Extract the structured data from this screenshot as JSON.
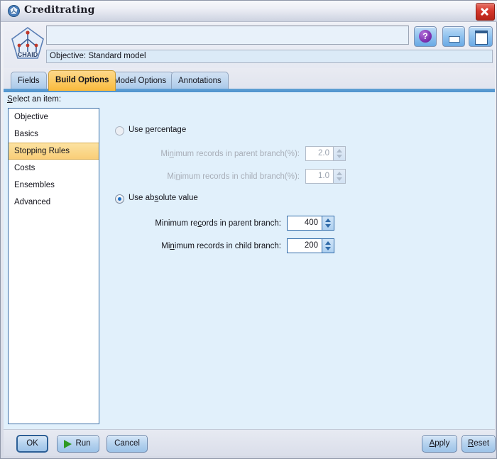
{
  "window": {
    "title": "Creditrating",
    "title_icon": "chaid-node-icon",
    "close_icon": "close-icon"
  },
  "header": {
    "model_icon": "chaid-model-icon",
    "model_icon_label": "CHAID",
    "name_value": "",
    "objective_text": "Objective: Standard model",
    "buttons": [
      {
        "name": "help-button",
        "icon": "help-icon",
        "glyph": "?"
      },
      {
        "name": "minimize-button",
        "icon": "minimize-icon"
      },
      {
        "name": "maximize-button",
        "icon": "maximize-icon"
      }
    ]
  },
  "tabs": [
    {
      "label": "Fields",
      "active": false
    },
    {
      "label": "Build Options",
      "active": true
    },
    {
      "label": "Model Options",
      "active": false
    },
    {
      "label": "Annotations",
      "active": false
    }
  ],
  "sidebar": {
    "label_prefix": "S",
    "label_rest": "elect an item:",
    "items": [
      {
        "label": "Objective",
        "selected": false
      },
      {
        "label": "Basics",
        "selected": false
      },
      {
        "label": "Stopping Rules",
        "selected": true
      },
      {
        "label": "Costs",
        "selected": false
      },
      {
        "label": "Ensembles",
        "selected": false
      },
      {
        "label": "Advanced",
        "selected": false
      }
    ]
  },
  "panel": {
    "percentage": {
      "radio_label_pre": "Use ",
      "radio_label_mnemonic": "p",
      "radio_label_post": "ercentage",
      "selected": false,
      "enabled": false,
      "parent": {
        "label_pre": "Mi",
        "label_mnemonic": "n",
        "label_post": "imum records in parent branch(%):",
        "value": "2.0"
      },
      "child": {
        "label_pre": "Mi",
        "label_mnemonic": "n",
        "label_post": "imum records in child branch(%):",
        "value": "1.0"
      }
    },
    "absolute": {
      "radio_label_pre": "Use ab",
      "radio_label_mnemonic": "s",
      "radio_label_post": "olute value",
      "selected": true,
      "enabled": true,
      "parent": {
        "label_pre": "Minimum re",
        "label_mnemonic": "c",
        "label_post": "ords in parent branch:",
        "value": "400"
      },
      "child": {
        "label_pre": "Mi",
        "label_mnemonic": "n",
        "label_post": "imum records in child branch:",
        "value": "200"
      }
    }
  },
  "footer": {
    "ok": "OK",
    "run": "Run",
    "run_icon": "play-icon",
    "cancel": "Cancel",
    "apply_pre": "",
    "apply_mnemonic": "A",
    "apply_post": "pply",
    "reset_pre": "",
    "reset_mnemonic": "R",
    "reset_post": "eset"
  },
  "colors": {
    "accent_blue": "#2f6aa8",
    "selection_amber": "#f9ce77",
    "body_bg": "#e1f0fb",
    "close_red": "#d4372c"
  }
}
